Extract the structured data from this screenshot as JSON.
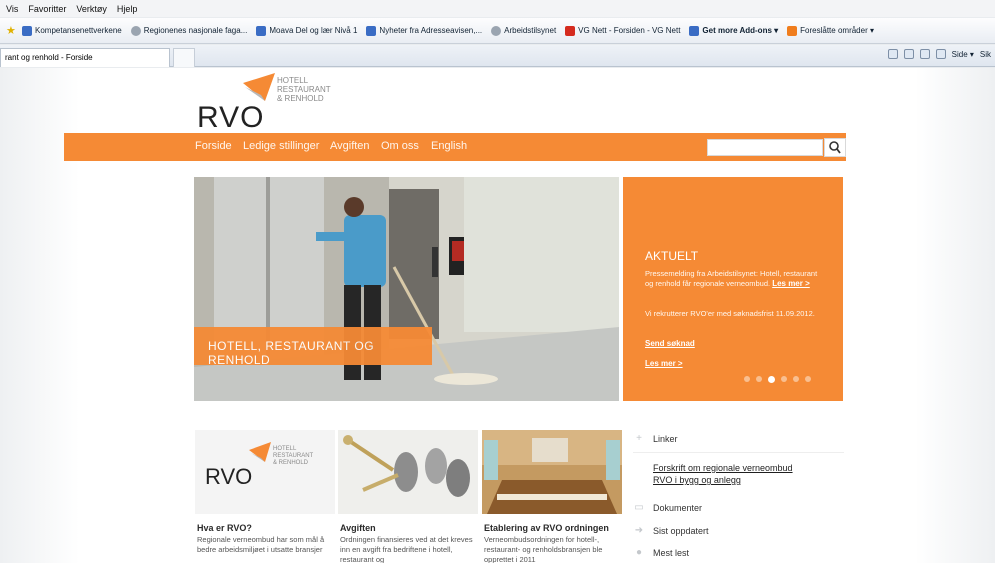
{
  "browser": {
    "menu": [
      "Vis",
      "Favoritter",
      "Verktøy",
      "Hjelp"
    ],
    "favorites": [
      {
        "label": "Kompetansenettverkene",
        "icon": "ie-page-icon"
      },
      {
        "label": "Regionenes nasjonale faga...",
        "icon": "globe-icon"
      },
      {
        "label": "Moava  Del og lær  Nivå 1",
        "icon": "ie-page-icon"
      },
      {
        "label": "Nyheter fra Adresseavisen,...",
        "icon": "news-icon"
      },
      {
        "label": "Arbeidstilsynet",
        "icon": "globe-icon"
      },
      {
        "label": "VG Nett - Forsiden - VG Nett",
        "icon": "vg-icon"
      },
      {
        "label": "Get more Add-ons ▾",
        "icon": "ie-page-icon"
      },
      {
        "label": "Foreslåtte områder ▾",
        "icon": "suggested-sites-icon"
      }
    ],
    "tab_title": "rant og renhold - Forside",
    "command_bar": [
      "Side ▾",
      "Sik"
    ]
  },
  "site": {
    "logo_text": "RVO",
    "logo_sub": [
      "HOTELL",
      "RESTAURANT",
      "& RENHOLD"
    ],
    "nav": [
      "Forside",
      "Ledige stillinger",
      "Avgiften",
      "Om oss",
      "English"
    ],
    "search_placeholder": "",
    "hero_label": "HOTELL, RESTAURANT OG RENHOLD",
    "news": {
      "title": "AKTUELT",
      "item1": "Pressemelding fra Arbeidstilsynet: Hotell, restaurant og renhold får regionale verneombud.",
      "item1_link": "Les mer >",
      "item2": "Vi rekrutterer RVO'er med søknadsfrist 11.09.2012.",
      "apply_link": "Send søknad",
      "more_link": "Les mer  >"
    },
    "tiles": [
      {
        "title": "Hva er RVO?",
        "text": "Regionale verneombud har som mål å bedre arbeidsmiljøet i utsatte bransjer"
      },
      {
        "title": "Avgiften",
        "text": "Ordningen finansieres ved at det kreves inn en avgift fra bedriftene i hotell, restaurant og"
      },
      {
        "title": "Etablering av RVO ordningen",
        "text": "Verneombudsordningen for hotell-, restaurant- og renholdsbransjen ble opprettet i 2011"
      }
    ],
    "sidebar": {
      "links_heading": "Linker",
      "links": [
        "Forskrift om regionale verneombud",
        "RVO i bygg og anlegg"
      ],
      "documents": "Dokumenter",
      "recent": "Sist oppdatert",
      "most_read": "Mest lest"
    },
    "colors": {
      "accent": "#f58a35",
      "text": "#2b2b2b"
    }
  }
}
